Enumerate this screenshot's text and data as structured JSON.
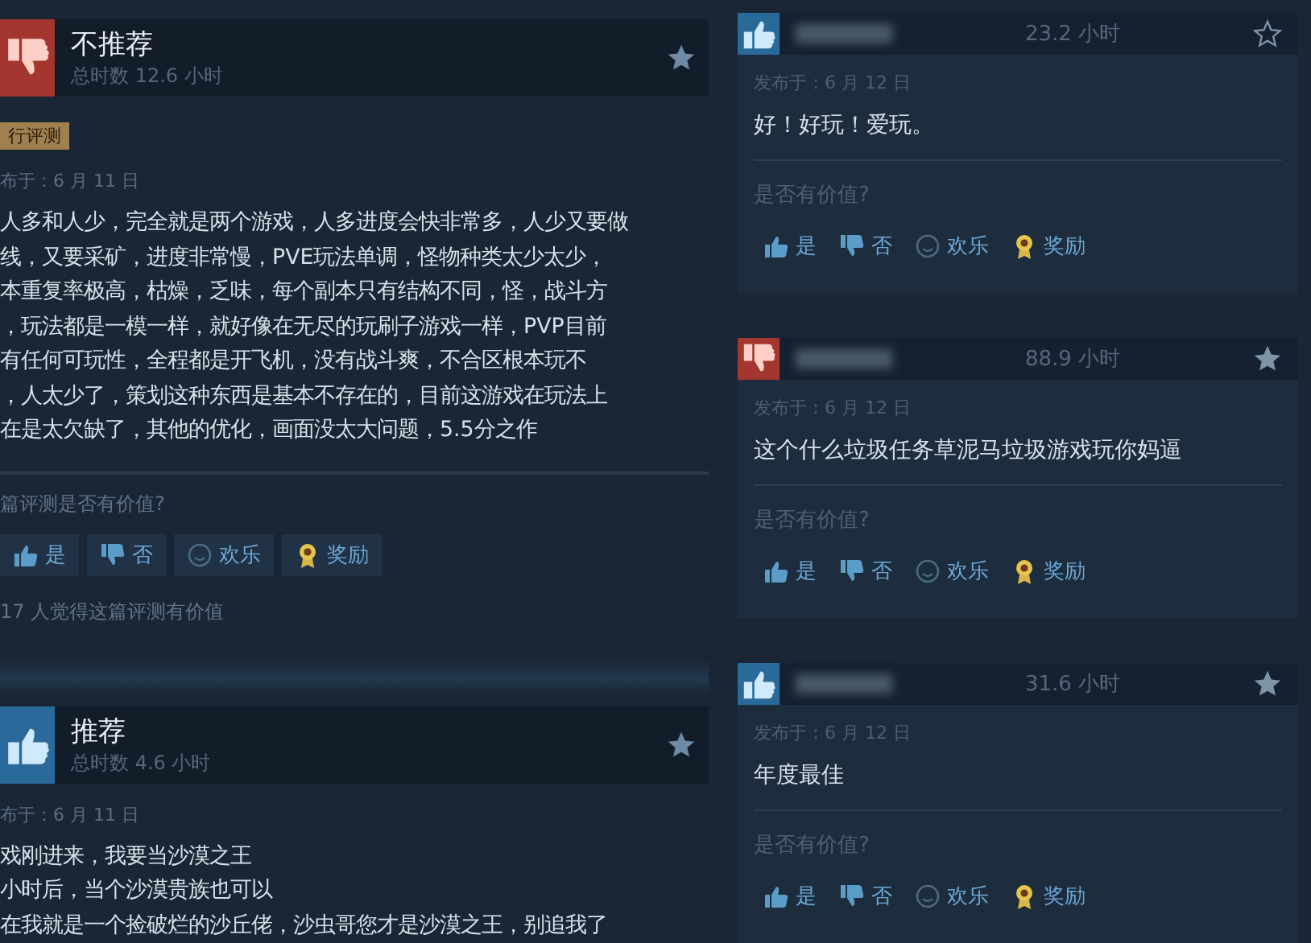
{
  "main_reviews": [
    {
      "verdict": "不推荐",
      "recommended": false,
      "hours": "总时数 12.6 小时",
      "badge": "行评测",
      "date": "布于：6 月 11 日",
      "lines": [
        "人多和人少，完全就是两个游戏，人多进度会快非常多，人少又要做",
        "线，又要采矿，进度非常慢，PVE玩法单调，怪物种类太少太少，",
        "本重复率极高，枯燥，乏味，每个副本只有结构不同，怪，战斗方",
        "，玩法都是一模一样，就好像在无尽的玩刷子游戏一样，PVP目前",
        "有任何可玩性，全程都是开飞机，没有战斗爽，不合区根本玩不",
        "，人太少了，策划这种东西是基本不存在的，目前这游戏在玩法上",
        "在是太欠缺了，其他的优化，画面没太大问题，5.5分之作"
      ],
      "question": "篇评测是否有价值?",
      "buttons": [
        "是",
        "否",
        "欢乐",
        "奖励"
      ],
      "helpful": "17 人觉得这篇评测有价值"
    },
    {
      "verdict": "推荐",
      "recommended": true,
      "hours": "总时数 4.6 小时",
      "date": "布于：6 月 11 日",
      "lines": [
        "戏刚进来，我要当沙漠之王",
        "小时后，当个沙漠贵族也可以",
        "在我就是一个捡破烂的沙丘佬，沙虫哥您才是沙漠之王，别追我了"
      ]
    }
  ],
  "side_reviews": [
    {
      "recommended": true,
      "hours": "23.2 小时",
      "starred": false,
      "date": "发布于：6 月 12 日",
      "text": "好！好玩！爱玩。",
      "question": "是否有价值?",
      "buttons": [
        "是",
        "否",
        "欢乐",
        "奖励"
      ]
    },
    {
      "recommended": false,
      "hours": "88.9 小时",
      "starred": true,
      "date": "发布于：6 月 12 日",
      "text": "这个什么垃圾任务草泥马垃圾游戏玩你妈逼",
      "question": "是否有价值?",
      "buttons": [
        "是",
        "否",
        "欢乐",
        "奖励"
      ]
    },
    {
      "recommended": true,
      "hours": "31.6 小时",
      "starred": true,
      "date": "发布于：6 月 12 日",
      "text": "年度最佳",
      "question": "是否有价值?",
      "buttons": [
        "是",
        "否",
        "欢乐",
        "奖励"
      ]
    }
  ]
}
